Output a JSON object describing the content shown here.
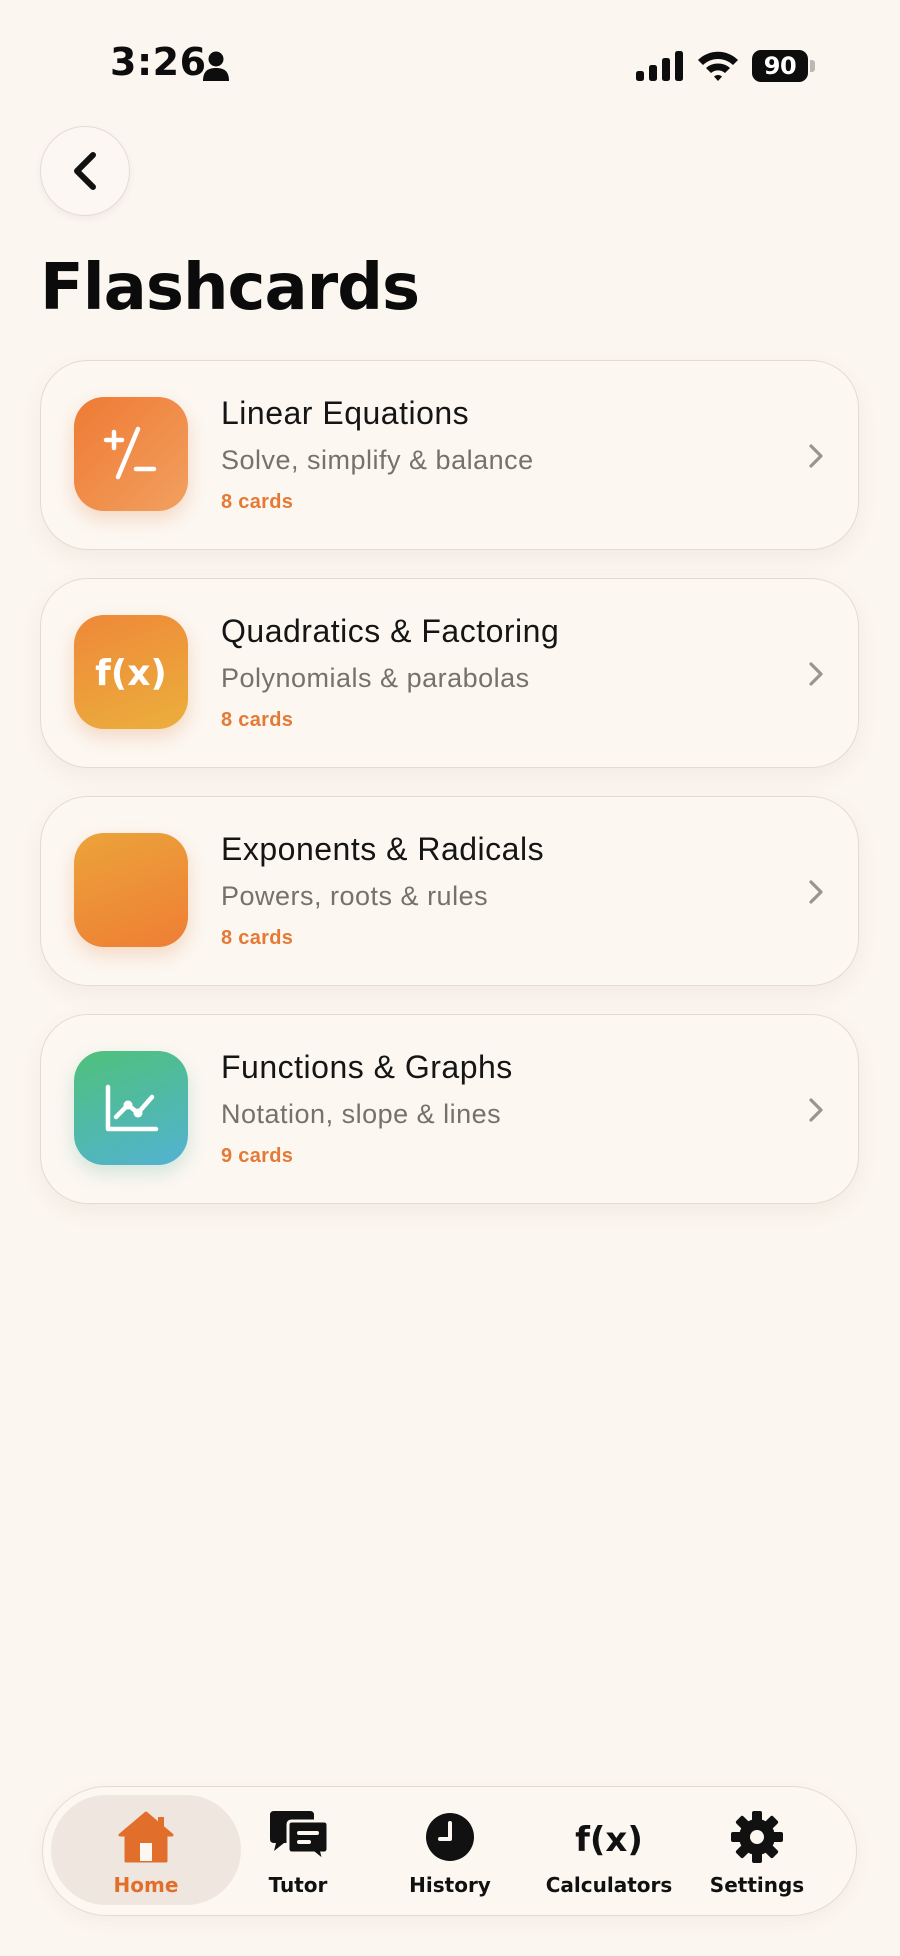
{
  "status_bar": {
    "time": "3:26",
    "battery": "90"
  },
  "header": {
    "title": "Flashcards"
  },
  "decks": [
    {
      "title": "Linear Equations",
      "subtitle": "Solve, simplify & balance",
      "count": "8 cards",
      "icon": "plus-minus-icon",
      "gradient": [
        "#EE7A33",
        "#F2A060"
      ]
    },
    {
      "title": "Quadratics & Factoring",
      "subtitle": "Polynomials & parabolas",
      "count": "8 cards",
      "icon": "function-icon",
      "icon_text": "f(x)",
      "gradient": [
        "#EF8C38",
        "#ECAE3C"
      ]
    },
    {
      "title": "Exponents & Radicals",
      "subtitle": "Powers, roots & rules",
      "count": "8 cards",
      "icon": "exponent-icon",
      "gradient": [
        "#ECA33A",
        "#EE7E35"
      ]
    },
    {
      "title": "Functions & Graphs",
      "subtitle": "Notation, slope & lines",
      "count": "9 cards",
      "icon": "line-chart-icon",
      "gradient": [
        "#4FC17A",
        "#52B2D2"
      ]
    }
  ],
  "tabs": [
    {
      "label": "Home",
      "icon": "home-icon",
      "active": true
    },
    {
      "label": "Tutor",
      "icon": "chat-bubbles-icon",
      "active": false
    },
    {
      "label": "History",
      "icon": "clock-icon",
      "active": false
    },
    {
      "label": "Calculators",
      "icon": "function-icon",
      "icon_text": "f(x)",
      "active": false
    },
    {
      "label": "Settings",
      "icon": "gear-icon",
      "active": false
    }
  ],
  "colors": {
    "background": "#FCF6F0",
    "accent": "#E47A35",
    "card_border": "#E2DBD3",
    "active_tab_bg": "#EFE7DF"
  }
}
